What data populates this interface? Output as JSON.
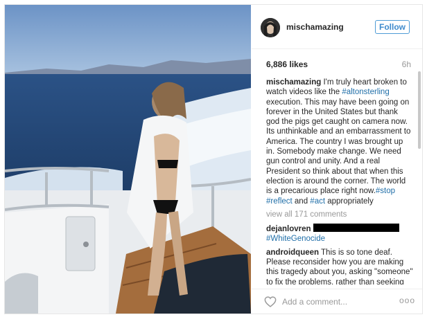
{
  "post": {
    "username": "mischamazing",
    "follow_label": "Follow",
    "likes": "6,886 likes",
    "time": "6h",
    "caption": {
      "user": "mischamazing",
      "text_1": " I'm truly heart broken to watch videos like the ",
      "tag_1": "#altonsterling",
      "text_2": " execution. This may have been going on forever in the United States but thank god the pigs get caught on camera now. Its unthinkable and an embarrassment to America. The country I was brought up in. Somebody make change. We need gun control and unity. And a real President so think about that when this election is around the corner. The world is a precarious place right now.",
      "tag_2": "#stop",
      "text_3": " ",
      "tag_3": "#reflect",
      "text_4": " and ",
      "tag_4": "#act",
      "text_5": " appropriately"
    },
    "view_all": "view all 171 comments",
    "comments": [
      {
        "user": "dejanlovren",
        "tag": "#WhiteGenocide"
      },
      {
        "user": "androidqueen",
        "text": " This is so tone deaf. Please reconsider how you are making this tragedy about you, asking \"someone\" to fix the problems, rather than seeking out constructive ways to actually make a difference."
      }
    ],
    "add_comment_placeholder": "Add a comment...",
    "more_label": "ooo"
  },
  "icons": {
    "heart": "heart-icon",
    "more": "more-options-icon"
  },
  "colors": {
    "link_blue": "#1f6ea8",
    "follow_blue": "#3f8bcd",
    "muted_gray": "#999999"
  }
}
